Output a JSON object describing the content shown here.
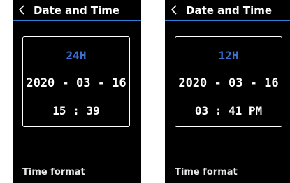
{
  "colors": {
    "background": "#000000",
    "accent_line": "#2f7fd6",
    "format_label": "#3d6fd1",
    "text": "#ffffff"
  },
  "screens": [
    {
      "header": {
        "back_icon": "chevron-left-icon",
        "title": "Date and Time"
      },
      "display": {
        "format": "24H",
        "date": "2020 - 03 - 16",
        "time": "15 : 39"
      },
      "footer": {
        "label": "Time format"
      }
    },
    {
      "header": {
        "back_icon": "chevron-left-icon",
        "title": "Date and Time"
      },
      "display": {
        "format": "12H",
        "date": "2020 - 03 - 16",
        "time": "03 : 41 PM"
      },
      "footer": {
        "label": "Time format"
      }
    }
  ]
}
